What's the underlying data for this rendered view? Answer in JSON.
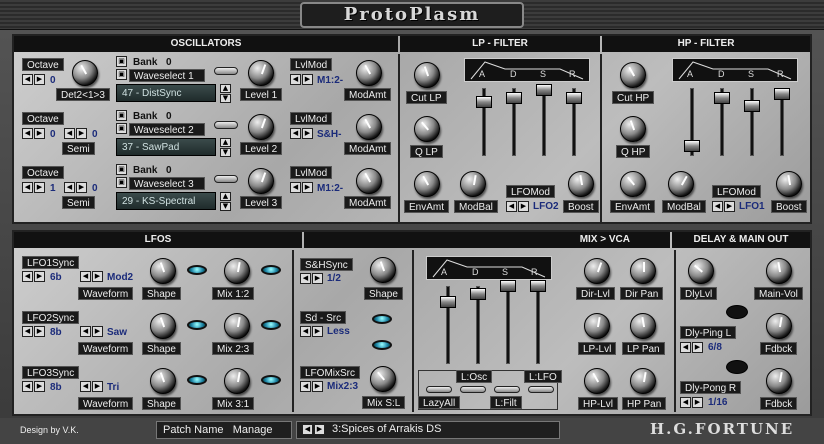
{
  "app": {
    "title": "ProtoPlasm"
  },
  "sections": {
    "osc": "OSCILLATORS",
    "lp": "LP - FILTER",
    "hp": "HP - FILTER",
    "lfos": "LFOS",
    "mix": "MIX > VCA",
    "delay": "DELAY & MAIN OUT"
  },
  "osc": [
    {
      "octave_label": "Octave",
      "octave": "0",
      "det_label": "Det2<1>3",
      "bank_label": "Bank",
      "bank": "0",
      "wave_label": "Waveselect 1",
      "patch": "47 - DistSync",
      "level_label": "Level 1",
      "lvlmod_label": "LvlMod",
      "lvlmod": "M1:2-",
      "modamt_label": "ModAmt"
    },
    {
      "octave_label": "Octave",
      "octave": "0",
      "semi_label": "Semi",
      "semi": "0",
      "bank_label": "Bank",
      "bank": "0",
      "wave_label": "Waveselect 2",
      "patch": "37 - SawPad",
      "level_label": "Level 2",
      "lvlmod_label": "LvlMod",
      "lvlmod": "S&H-",
      "modamt_label": "ModAmt"
    },
    {
      "octave_label": "Octave",
      "octave": "1",
      "semi_label": "Semi",
      "semi": "0",
      "bank_label": "Bank",
      "bank": "0",
      "wave_label": "Waveselect 3",
      "patch": "29 - KS-Spectral",
      "level_label": "Level 3",
      "lvlmod_label": "LvlMod",
      "lvlmod": "M1:2-",
      "modamt_label": "ModAmt"
    }
  ],
  "lp": {
    "cut": "Cut LP",
    "q": "Q LP",
    "env": "EnvAmt",
    "modbal": "ModBal",
    "lfomod_label": "LFOMod",
    "lfomod": "LFO2",
    "boost": "Boost",
    "adsr": [
      "A",
      "D",
      "S",
      "R"
    ]
  },
  "hp": {
    "cut": "Cut HP",
    "q": "Q HP",
    "env": "EnvAmt",
    "modbal": "ModBal",
    "lfomod_label": "LFOMod",
    "lfomod": "LFO1",
    "boost": "Boost",
    "adsr": [
      "A",
      "D",
      "S",
      "R"
    ]
  },
  "lfo": [
    {
      "sync_label": "LFO1Sync",
      "sync": "6b",
      "wave": "Mod2",
      "wave_label": "Waveform",
      "shape": "Shape",
      "mix": "Mix 1:2"
    },
    {
      "sync_label": "LFO2Sync",
      "sync": "8b",
      "wave": "Saw",
      "wave_label": "Waveform",
      "shape": "Shape",
      "mix": "Mix 2:3"
    },
    {
      "sync_label": "LFO3Sync",
      "sync": "8b",
      "wave": "Tri",
      "wave_label": "Waveform",
      "shape": "Shape",
      "mix": "Mix 3:1"
    }
  ],
  "sh": {
    "sync_label": "S&HSync",
    "sync": "1/2",
    "shape": "Shape",
    "src_label": "Sd - Src",
    "src": "Less",
    "mixsrc_label": "LFOMixSrc",
    "mixsrc": "Mix2:3",
    "mixsl": "Mix S:L"
  },
  "mix": {
    "adsr": [
      "A",
      "D",
      "S",
      "R"
    ],
    "losc": "L:Osc",
    "llfo": "L:LFO",
    "lazy": "LazyAll",
    "lfilt": "L:Filt",
    "dirlvl": "Dir-Lvl",
    "dirpan": "Dir Pan",
    "lplvl": "LP-Lvl",
    "lppan": "LP Pan",
    "hplvl": "HP-Lvl",
    "hppan": "HP Pan"
  },
  "delay": {
    "dlylvl": "DlyLvl",
    "mainvol": "Main-Vol",
    "pingl": "Dly-Ping L",
    "pingl_val": "6/8",
    "fdbck1": "Fdbck",
    "pongr": "Dly-Pong R",
    "pongr_val": "1/16",
    "fdbck2": "Fdbck"
  },
  "status": {
    "design": "Design by V.K.",
    "patch_name": "Patch Name",
    "manage": "Manage",
    "preset": "3:Spices of Arrakis DS",
    "brand": "H.G.FORTUNE"
  }
}
